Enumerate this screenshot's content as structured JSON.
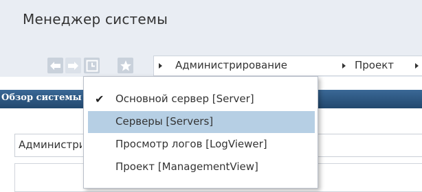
{
  "window": {
    "title": "Менеджер системы"
  },
  "nav": {
    "back_icon": "arrow-left-icon",
    "forward_icon": "arrow-right-icon",
    "history_icon": "history-icon",
    "favorites_icon": "star-icon"
  },
  "breadcrumb": {
    "items": [
      "Администрирование",
      "Проект"
    ]
  },
  "section": {
    "title": "Обзор системы"
  },
  "admin_field": {
    "text": "Администрирование"
  },
  "context_menu": {
    "items": [
      {
        "label": "Основной сервер [Server]",
        "checked": true,
        "highlighted": false
      },
      {
        "label": "Серверы [Servers]",
        "checked": false,
        "highlighted": true
      },
      {
        "label": "Просмотр логов [LogViewer]",
        "checked": false,
        "highlighted": false
      },
      {
        "label": "Проект [ManagementView]",
        "checked": false,
        "highlighted": false
      }
    ]
  },
  "colors": {
    "chrome_bg": "#e9edf3",
    "nav_button_bg": "#cfd6df",
    "header_blue": "#2c5580",
    "menu_highlight": "#b6cfe4"
  }
}
